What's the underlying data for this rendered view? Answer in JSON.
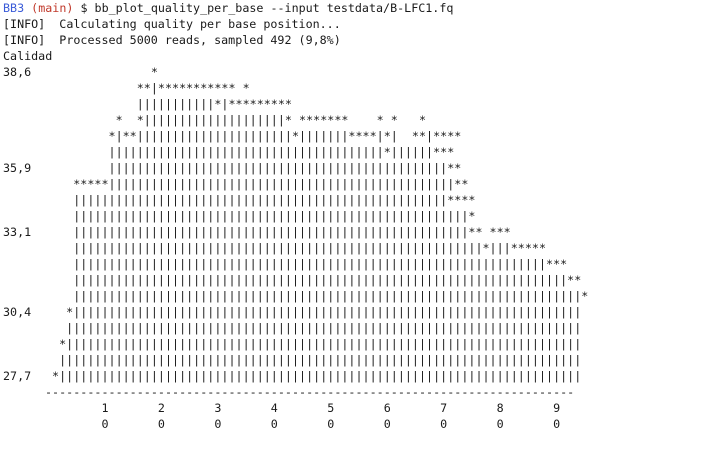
{
  "prompt": {
    "host": "BB3",
    "branch": "(main)",
    "symbol": "$",
    "command": "bb_plot_quality_per_base --input testdata/B-LFC1.fq"
  },
  "output": {
    "info1": "[INFO]  Calculating quality per base position...",
    "info2": "[INFO]  Processed 5000 reads, sampled 492 (9,8%)",
    "y_title": "Calidad"
  },
  "plot": {
    "rows": [
      {
        "label": "38,6",
        "bars": "               *"
      },
      {
        "label": "",
        "bars": "             **|*********** *"
      },
      {
        "label": "",
        "bars": "             |||||||||||*|*********"
      },
      {
        "label": "",
        "bars": "          *  *||||||||||||||||||||* *******    * *   *"
      },
      {
        "label": "",
        "bars": "         *|**||||||||||||||||||||||*|||||||****|*|  **|****"
      },
      {
        "label": "",
        "bars": "         |||||||||||||||||||||||||||||||||||||||*||||||***"
      },
      {
        "label": "35,9",
        "bars": "         ||||||||||||||||||||||||||||||||||||||||||||||||**"
      },
      {
        "label": "",
        "bars": "    *****|||||||||||||||||||||||||||||||||||||||||||||||||**"
      },
      {
        "label": "",
        "bars": "    |||||||||||||||||||||||||||||||||||||||||||||||||||||****"
      },
      {
        "label": "",
        "bars": "    ||||||||||||||||||||||||||||||||||||||||||||||||||||||||*"
      },
      {
        "label": "33,1",
        "bars": "    ||||||||||||||||||||||||||||||||||||||||||||||||||||||||** ***"
      },
      {
        "label": "",
        "bars": "    ||||||||||||||||||||||||||||||||||||||||||||||||||||||||||*|||*****"
      },
      {
        "label": "",
        "bars": "    |||||||||||||||||||||||||||||||||||||||||||||||||||||||||||||||||||***"
      },
      {
        "label": "",
        "bars": "    ||||||||||||||||||||||||||||||||||||||||||||||||||||||||||||||||||||||**"
      },
      {
        "label": "",
        "bars": "    ||||||||||||||||||||||||||||||||||||||||||||||||||||||||||||||||||||||||*"
      },
      {
        "label": "30,4",
        "bars": "   *||||||||||||||||||||||||||||||||||||||||||||||||||||||||||||||||||||||||"
      },
      {
        "label": "",
        "bars": "   |||||||||||||||||||||||||||||||||||||||||||||||||||||||||||||||||||||||||"
      },
      {
        "label": "",
        "bars": "  *|||||||||||||||||||||||||||||||||||||||||||||||||||||||||||||||||||||||||"
      },
      {
        "label": "",
        "bars": "  ||||||||||||||||||||||||||||||||||||||||||||||||||||||||||||||||||||||||||"
      },
      {
        "label": "27,7",
        "bars": " *||||||||||||||||||||||||||||||||||||||||||||||||||||||||||||||||||||||||||"
      }
    ],
    "axis_line": "---------------------------------------------------------------------------",
    "x_ticks": "        1       2       3       4       5       6       7       8       9",
    "x_zeros": "        0       0       0       0       0       0       0       0       0"
  }
}
